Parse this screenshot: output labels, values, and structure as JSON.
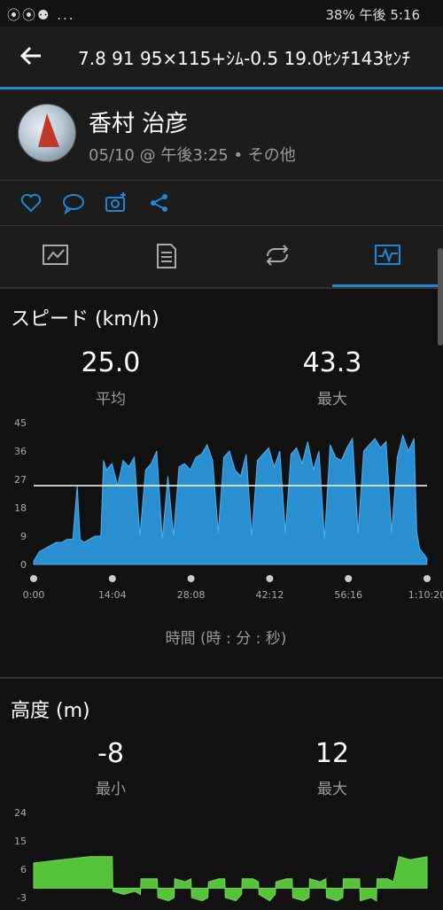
{
  "status": {
    "left": "⦿⦿⚉ ...",
    "right": "38% 午後 5:16"
  },
  "header": {
    "title": "7.8 91 95×115+ｼﾑ-0.5 19.0ｾﾝﾁ143ｾﾝﾁ"
  },
  "profile": {
    "name": "香村 治彦",
    "meta": "05/10 @ 午後3:25 • その他"
  },
  "actions": {
    "icons": [
      "heart-icon",
      "comment-icon",
      "camera-add-icon",
      "share-icon"
    ]
  },
  "tabs": [
    {
      "icon": "summary-icon",
      "active": false
    },
    {
      "icon": "details-icon",
      "active": false
    },
    {
      "icon": "laps-icon",
      "active": false
    },
    {
      "icon": "charts-icon",
      "active": true
    }
  ],
  "colors": {
    "accent": "#1e88d8",
    "speed_fill": "#2a8fd0",
    "elev_fill": "#56c43a",
    "bg": "#111111"
  },
  "speed": {
    "title": "スピード (km/h)",
    "avg_value": "25.0",
    "avg_label": "平均",
    "max_value": "43.3",
    "max_label": "最大",
    "xlabel": "時間 (時 : 分 : 秒)"
  },
  "elevation": {
    "title": "高度 (m)",
    "min_value": "-8",
    "min_label": "最小",
    "max_value": "12",
    "max_label": "最大"
  },
  "chart_data": [
    {
      "type": "area",
      "title": "",
      "ylabel": "",
      "y_ticks": [
        0,
        9,
        18,
        27,
        36,
        45
      ],
      "x_ticks": [
        "0:00",
        "14:04",
        "28:08",
        "42:12",
        "56:16",
        "1:10:20"
      ],
      "ylim": [
        0,
        45
      ],
      "xlim": [
        0,
        70.33
      ],
      "average_line": 25.0,
      "x": [
        0,
        1,
        2,
        3,
        4,
        5,
        6,
        7,
        7.8,
        8.3,
        9,
        10,
        11,
        12,
        12.5,
        13,
        14,
        15,
        16,
        17,
        18,
        19,
        20,
        21,
        22,
        23,
        24,
        25,
        26,
        27,
        28,
        29,
        30,
        31,
        32,
        33,
        34,
        35,
        36,
        37,
        38,
        39,
        40,
        41,
        42,
        43,
        44,
        45,
        46,
        47,
        48,
        49,
        50,
        51,
        52,
        53,
        54,
        55,
        56,
        57,
        58,
        59,
        60,
        61,
        62,
        63,
        64,
        65,
        66,
        67,
        68,
        68.5,
        69,
        70.3
      ],
      "y": [
        1,
        4,
        5,
        6,
        7,
        7,
        8,
        8,
        25,
        8,
        7,
        8,
        9,
        9,
        33,
        30,
        32,
        25,
        33,
        31,
        34,
        9,
        30,
        32,
        36,
        8,
        28,
        9,
        31,
        32,
        30,
        34,
        35,
        38,
        33,
        10,
        34,
        36,
        30,
        28,
        35,
        9,
        33,
        35,
        37,
        31,
        36,
        10,
        35,
        37,
        32,
        39,
        30,
        36,
        8,
        38,
        34,
        33,
        37,
        40,
        10,
        36,
        38,
        40,
        37,
        39,
        10,
        34,
        41,
        36,
        40,
        10,
        5,
        2
      ]
    },
    {
      "type": "area",
      "title": "",
      "ylabel": "",
      "y_ticks": [
        -3,
        6,
        15,
        24
      ],
      "ylim": [
        -3,
        24
      ],
      "x": [
        0,
        5,
        10,
        12,
        14,
        14.1,
        16,
        18,
        19,
        19.1,
        21,
        22,
        22.1,
        24,
        25,
        25.1,
        27,
        28,
        28.1,
        30,
        31,
        31.1,
        33,
        34,
        34.1,
        36,
        37,
        37.1,
        39,
        40,
        40.1,
        42,
        43,
        43.1,
        45,
        46,
        46.1,
        48,
        49,
        49.1,
        51,
        52,
        52.1,
        54,
        55,
        55.1,
        57,
        58,
        58.1,
        60,
        61,
        61.1,
        63,
        64,
        65,
        67,
        70
      ],
      "y": [
        8,
        9,
        10,
        10,
        10,
        -1,
        -2,
        -1,
        -2,
        3,
        3,
        3,
        -3,
        -4,
        -3,
        3,
        2,
        3,
        -3,
        -4,
        -3,
        2,
        3,
        3,
        -3,
        -4,
        -2,
        3,
        3,
        2,
        -2,
        -4,
        -2,
        2,
        3,
        3,
        -3,
        -4,
        -3,
        3,
        2,
        3,
        -3,
        -4,
        -3,
        3,
        3,
        3,
        -4,
        -3,
        -4,
        3,
        3,
        2,
        10,
        9,
        10
      ]
    }
  ]
}
